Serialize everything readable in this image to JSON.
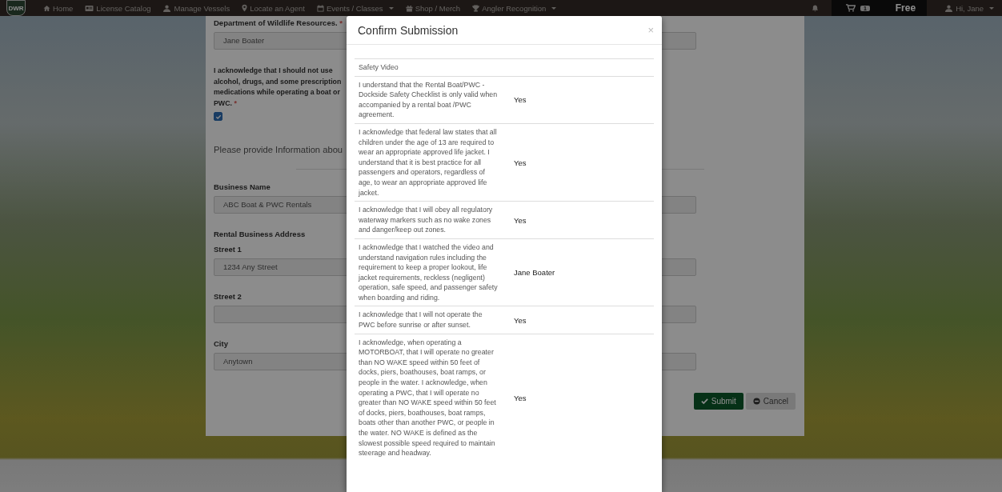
{
  "navbar": {
    "logo_text": "DWR",
    "items": [
      {
        "label": "Home",
        "dropdown": false
      },
      {
        "label": "License Catalog",
        "dropdown": false
      },
      {
        "label": "Manage Vessels",
        "dropdown": false
      },
      {
        "label": "Locate an Agent",
        "dropdown": false
      },
      {
        "label": "Events / Classes",
        "dropdown": true
      },
      {
        "label": "Shop / Merch",
        "dropdown": false
      },
      {
        "label": "Angler Recognition",
        "dropdown": true
      }
    ],
    "cart_count": "1",
    "plan": "Free",
    "user": "Hi, Jane"
  },
  "form": {
    "fields": [
      {
        "kind": "input",
        "label": "Department of Wildlife Resources.",
        "required_mark": "*",
        "value": "Jane Boater"
      },
      {
        "kind": "checkbox",
        "label": "I acknowledge that I should not use alcohol, drugs, and some prescription medications while operating a boat or PWC.",
        "required_mark": "*",
        "checked": true
      },
      {
        "kind": "heading",
        "label": "Please provide Information abou"
      },
      {
        "kind": "input",
        "label": "Business Name",
        "value": "ABC Boat & PWC Rentals"
      },
      {
        "kind": "group",
        "label": "Rental Business Address"
      },
      {
        "kind": "input",
        "label": "Street 1",
        "value": "1234 Any Street"
      },
      {
        "kind": "input",
        "label": "Street 2"
      },
      {
        "kind": "input",
        "label": "City",
        "value": "Anytown"
      }
    ],
    "buttons": [
      {
        "kind": "submit",
        "label": "Submit"
      },
      {
        "kind": "cancel",
        "label": "Cancel"
      }
    ]
  },
  "modal": {
    "title": "Confirm Submission",
    "close": "×",
    "rows": [
      {
        "kind": "section",
        "question": "Safety Video"
      },
      {
        "kind": "answer",
        "question": "I understand that the Rental Boat/PWC - Dockside Safety Checklist is only valid when accompanied by a rental boat /PWC agreement.",
        "answer": "Yes"
      },
      {
        "kind": "answer",
        "question": "I acknowledge that federal law states that all children under the age of 13 are required to wear an appropriate approved life jacket. I understand that it is best practice for all passengers and operators, regardless of age, to wear an appropriate approved life jacket.",
        "answer": "Yes"
      },
      {
        "kind": "answer",
        "question": "I acknowledge that I will obey all regulatory waterway markers such as no wake zones and danger/keep out zones.",
        "answer": "Yes"
      },
      {
        "kind": "answer",
        "question": "I acknowledge that I watched the video and understand navigation rules including the requirement to keep a proper lookout, life jacket requirements, reckless (negligent) operation, safe speed, and passenger safety when boarding and riding.",
        "answer": "Jane Boater"
      },
      {
        "kind": "answer",
        "question": "I acknowledge that I will not operate the PWC before sunrise or after sunset.",
        "answer": "Yes"
      },
      {
        "kind": "answer",
        "question": "I acknowledge, when operating a MOTORBOAT, that I will operate no greater than NO WAKE speed within 50 feet of docks, piers, boathouses, boat ramps, or people in the water. I acknowledge, when operating a PWC, that I will operate no greater than NO WAKE speed within 50 feet of docks, piers, boathouses, boat ramps, boats other than another PWC, or people in the water. NO WAKE is defined as the slowest possible speed required to maintain steerage and headway.",
        "answer": "Yes"
      }
    ]
  }
}
